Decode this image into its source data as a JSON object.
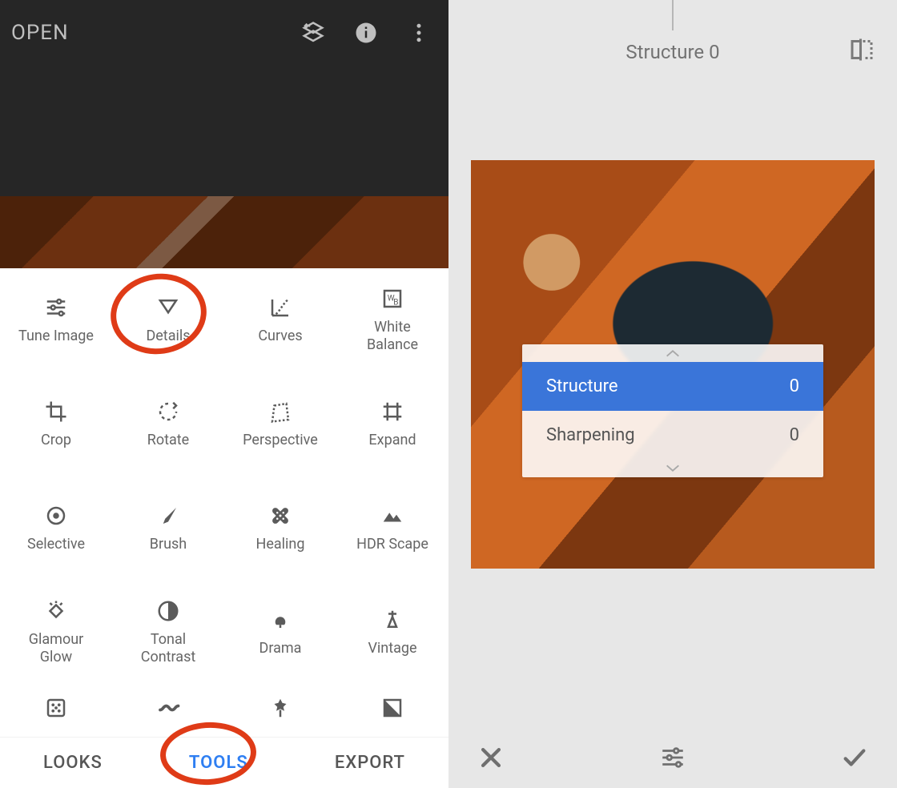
{
  "left": {
    "open_label": "OPEN",
    "preview_alt": "rusty peeling paint photo",
    "tools": [
      {
        "label": "Tune Image",
        "icon": "tune-image-icon"
      },
      {
        "label": "Details",
        "icon": "details-icon"
      },
      {
        "label": "Curves",
        "icon": "curves-icon"
      },
      {
        "label": "White\nBalance",
        "icon": "white-balance-icon"
      },
      {
        "label": "Crop",
        "icon": "crop-icon"
      },
      {
        "label": "Rotate",
        "icon": "rotate-icon"
      },
      {
        "label": "Perspective",
        "icon": "perspective-icon"
      },
      {
        "label": "Expand",
        "icon": "expand-icon"
      },
      {
        "label": "Selective",
        "icon": "selective-icon"
      },
      {
        "label": "Brush",
        "icon": "brush-icon"
      },
      {
        "label": "Healing",
        "icon": "healing-icon"
      },
      {
        "label": "HDR Scape",
        "icon": "hdr-scape-icon"
      },
      {
        "label": "Glamour\nGlow",
        "icon": "glamour-glow-icon"
      },
      {
        "label": "Tonal\nContrast",
        "icon": "tonal-contrast-icon"
      },
      {
        "label": "Drama",
        "icon": "drama-icon"
      },
      {
        "label": "Vintage",
        "icon": "vintage-icon"
      },
      {
        "label": "",
        "icon": "grainy-film-icon"
      },
      {
        "label": "",
        "icon": "retrolux-icon"
      },
      {
        "label": "",
        "icon": "grunge-icon"
      },
      {
        "label": "",
        "icon": "bw-icon"
      }
    ],
    "tabs": {
      "looks": "LOOKS",
      "tools": "TOOLS",
      "export": "EXPORT",
      "active": "tools"
    }
  },
  "right": {
    "header_param": "Structure",
    "header_value": "0",
    "sliders": [
      {
        "name": "Structure",
        "value": "0",
        "selected": true
      },
      {
        "name": "Sharpening",
        "value": "0",
        "selected": false
      }
    ]
  },
  "colors": {
    "accent_blue": "#3a75d9",
    "tab_blue": "#2f7ff2",
    "scribble_red": "#df3b17"
  }
}
